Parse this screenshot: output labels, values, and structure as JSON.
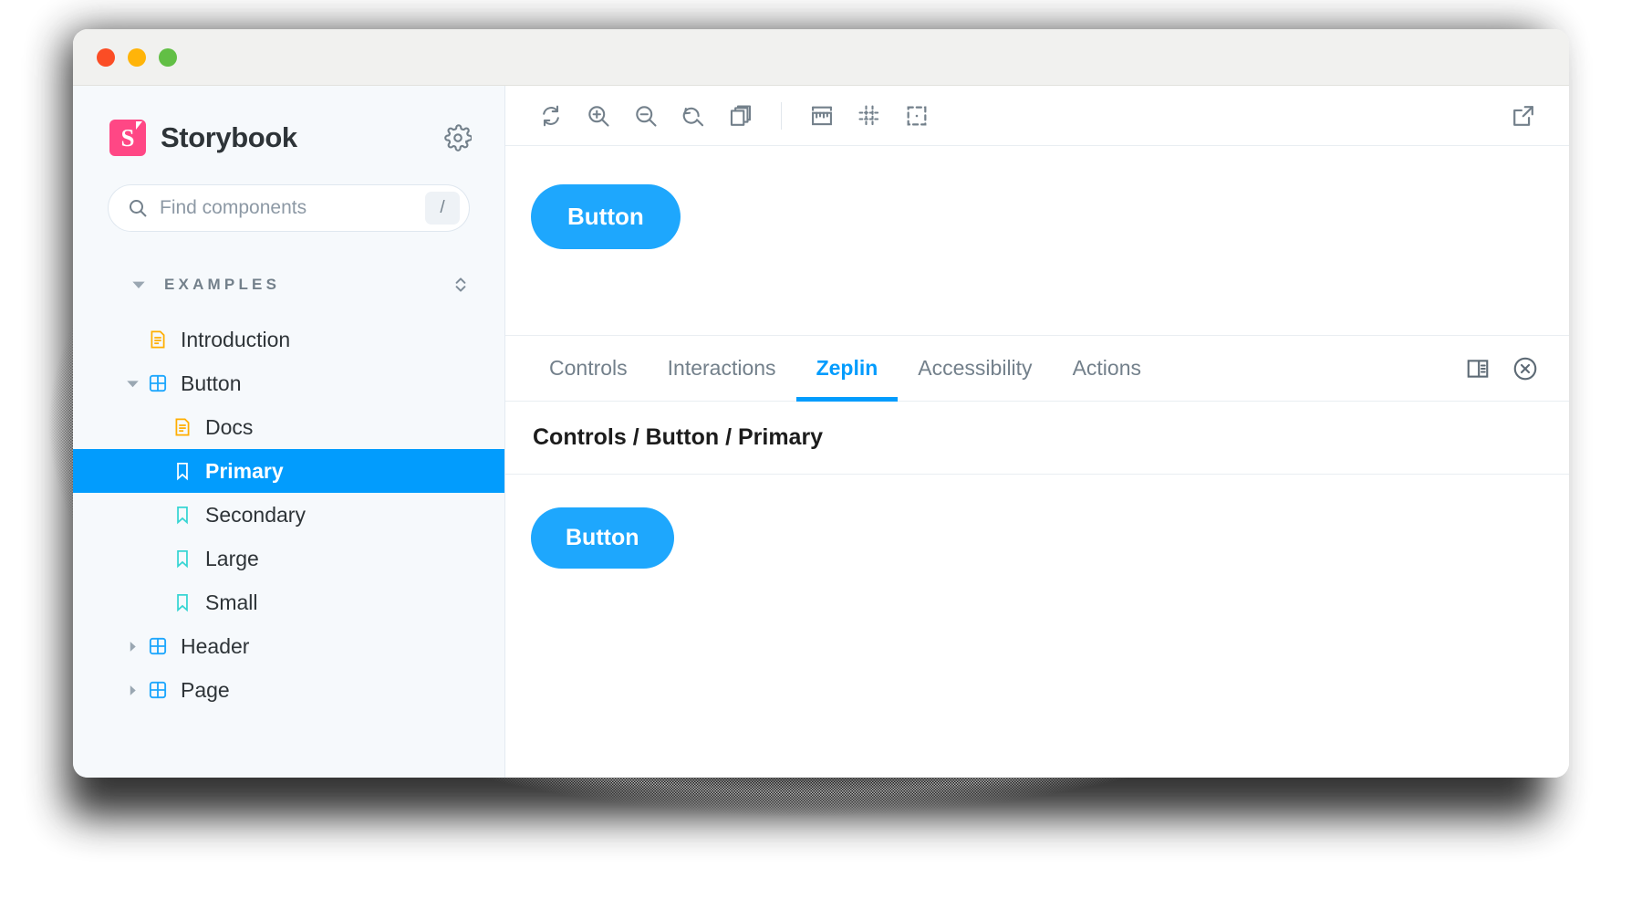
{
  "window": {
    "traffic_lights": [
      {
        "name": "close",
        "color": "#fb4d25"
      },
      {
        "name": "minimize",
        "color": "#ffb409"
      },
      {
        "name": "zoom",
        "color": "#62bf45"
      }
    ]
  },
  "sidebar": {
    "brand_name": "Storybook",
    "brand_logo_letter": "S",
    "brand_color": "#ff4785",
    "settings_icon": "gear-icon",
    "search": {
      "placeholder": "Find components",
      "value": "",
      "shortcut": "/",
      "icon": "search-icon"
    },
    "group": {
      "title": "EXAMPLES",
      "expanded": true,
      "collapse_all_icon": "chevron-expand-icon"
    },
    "tree": [
      {
        "label": "Introduction",
        "kind": "doc",
        "depth": 1,
        "twisty": "",
        "selected": false,
        "icon": "document-icon"
      },
      {
        "label": "Button",
        "kind": "component",
        "depth": 1,
        "twisty": "down",
        "selected": false,
        "icon": "component-icon"
      },
      {
        "label": "Docs",
        "kind": "doc",
        "depth": 2,
        "twisty": "",
        "selected": false,
        "icon": "document-icon"
      },
      {
        "label": "Primary",
        "kind": "story",
        "depth": 2,
        "twisty": "",
        "selected": true,
        "icon": "bookmark-icon"
      },
      {
        "label": "Secondary",
        "kind": "story",
        "depth": 2,
        "twisty": "",
        "selected": false,
        "icon": "bookmark-icon"
      },
      {
        "label": "Large",
        "kind": "story",
        "depth": 2,
        "twisty": "",
        "selected": false,
        "icon": "bookmark-icon"
      },
      {
        "label": "Small",
        "kind": "story",
        "depth": 2,
        "twisty": "",
        "selected": false,
        "icon": "bookmark-icon"
      },
      {
        "label": "Header",
        "kind": "component",
        "depth": 1,
        "twisty": "right",
        "selected": false,
        "icon": "component-icon"
      },
      {
        "label": "Page",
        "kind": "component",
        "depth": 1,
        "twisty": "right",
        "selected": false,
        "icon": "component-icon"
      }
    ],
    "selected_color": "#029cfd",
    "background_color": "#f6f9fc"
  },
  "toolbar": {
    "left_tools": [
      {
        "name": "remount-icon",
        "title": "Remount component"
      },
      {
        "name": "zoom-in-icon",
        "title": "Zoom in"
      },
      {
        "name": "zoom-out-icon",
        "title": "Zoom out"
      },
      {
        "name": "zoom-reset-icon",
        "title": "Reset zoom"
      },
      {
        "name": "backgrounds-icon",
        "title": "Change background"
      }
    ],
    "right_group_tools": [
      {
        "name": "measure-icon",
        "title": "Measure"
      },
      {
        "name": "grid-icon",
        "title": "Grid"
      },
      {
        "name": "outline-icon",
        "title": "Outline"
      }
    ],
    "end_tools": [
      {
        "name": "open-in-new-tab-icon",
        "title": "Open canvas in new tab"
      }
    ]
  },
  "preview": {
    "button_label": "Button",
    "button_color": "#1ea7fd"
  },
  "panel": {
    "tabs": [
      {
        "label": "Controls",
        "active": false
      },
      {
        "label": "Interactions",
        "active": false
      },
      {
        "label": "Zeplin",
        "active": true
      },
      {
        "label": "Accessibility",
        "active": false
      },
      {
        "label": "Actions",
        "active": false
      }
    ],
    "tools": [
      {
        "name": "panel-position-icon",
        "title": "Change addon orientation"
      },
      {
        "name": "close-panel-icon",
        "title": "Hide addons"
      }
    ],
    "title": "Controls / Button / Primary",
    "content": {
      "button_label": "Button",
      "button_color": "#1ea7fd"
    },
    "active_color": "#029cfd"
  }
}
